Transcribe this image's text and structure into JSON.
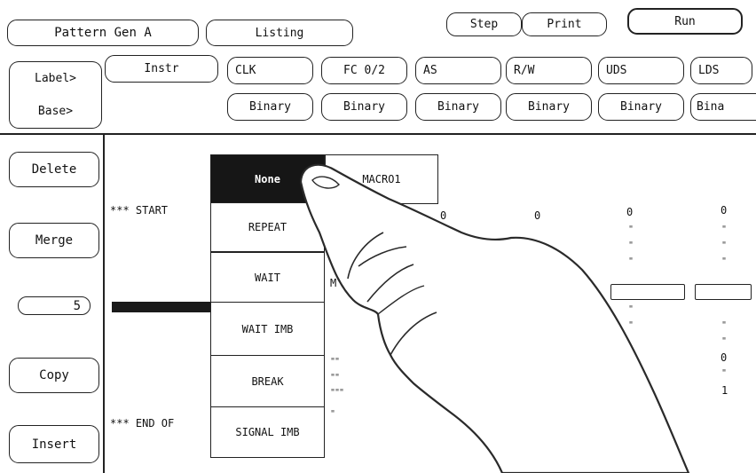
{
  "top_bar": {
    "pattern_label": "Pattern Gen A",
    "listing_label": "Listing",
    "step_label": "Step",
    "print_label": "Print",
    "run_label": "Run"
  },
  "label_row": {
    "row_title": "Label>",
    "labels": [
      "Instr",
      "CLK",
      "FC 0/2",
      "AS",
      "R/W",
      "UDS",
      "LDS"
    ]
  },
  "base_row": {
    "row_title": "Base>",
    "bases": [
      "Binary",
      "Binary",
      "Binary",
      "Binary",
      "Binary",
      "Bina"
    ]
  },
  "side_panel": {
    "delete_label": "Delete",
    "merge_label": "Merge",
    "count_value": "5",
    "copy_label": "Copy",
    "insert_label": "Insert"
  },
  "listing": {
    "start_marker": "*** START",
    "end_marker": "*** END OF",
    "macro_label": "MACRO1",
    "col_values": [
      "0",
      "0",
      "0",
      "0"
    ],
    "row_m": "M",
    "right_col_0": "0",
    "right_col_1": "1"
  },
  "instr_menu": {
    "items": [
      "None",
      "REPEAT",
      "WAIT",
      "WAIT IMB",
      "BREAK",
      "SIGNAL IMB"
    ],
    "selected": "None"
  }
}
